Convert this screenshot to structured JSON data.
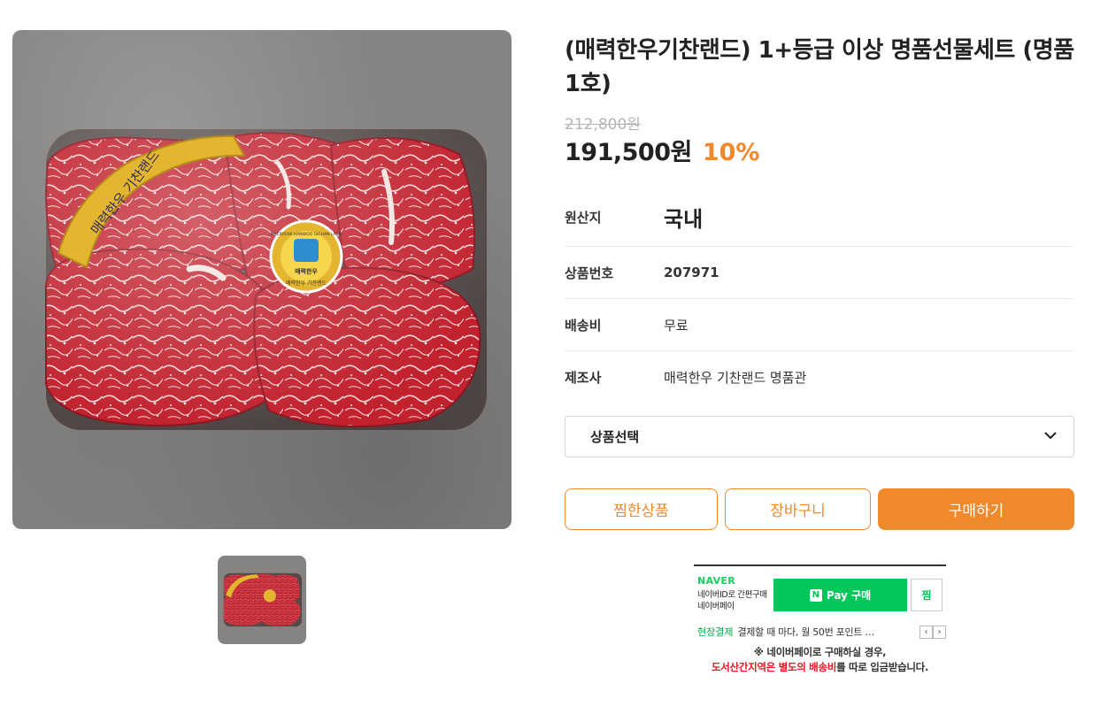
{
  "product": {
    "image_alt": "명품선물세트 한우 마블링 소고기",
    "title": "(매력한우기찬랜드) 1+등급 이상 명품선물세트 (명품1호)",
    "original_price": "212,800원",
    "sale_price": "191,500원",
    "discount": "10%",
    "package_label": {
      "ribbon_text": "매력한우 기찬랜드",
      "sticker_ring": "MAERYEOK HANWOO GICHAN LAND",
      "sticker_center": "매력한우",
      "sticker_bottom": "매력한우 기찬랜드"
    }
  },
  "info": [
    {
      "label": "원산지",
      "value": "국내"
    },
    {
      "label": "상품번호",
      "value": "207971"
    },
    {
      "label": "배송비",
      "value": "무료"
    },
    {
      "label": "제조사",
      "value": "매력한우 기찬랜드 명품관"
    }
  ],
  "option_select": {
    "label": "상품선택",
    "icon": "chevron-down-icon"
  },
  "buttons": {
    "wish": "찜한상품",
    "cart": "장바구니",
    "buy": "구매하기"
  },
  "naver_pay": {
    "logo": "NAVER",
    "sub_line1": "네이버ID로 간편구매",
    "sub_line2": "네이버페이",
    "pay_badge": "N",
    "pay_label": "Pay 구매",
    "wish_label": "찜",
    "promo_highlight": "현장결제",
    "promo_text": "결제할 때 마다, 월 50번 포인트 …",
    "prev_arrow": "‹",
    "next_arrow": "›",
    "note_line1": "※ 네이버페이로 구매하실 경우,",
    "note_red1": "도서산간지역은 별도의 배송비",
    "note_tail": "를 따로 입금받습니다."
  },
  "colors": {
    "accent": "#f0892b",
    "naver_green": "#03c75a",
    "strike_gray": "#b5b5b5",
    "note_red": "#e31b23"
  }
}
